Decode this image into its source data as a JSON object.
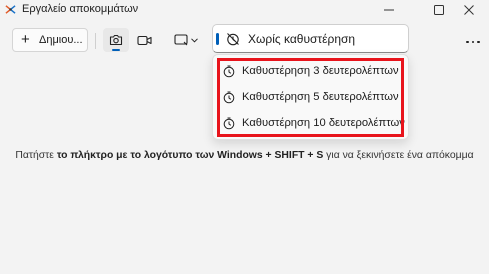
{
  "window": {
    "title": "Εργαλείο αποκομμάτων",
    "minimize_icon": "minimize-icon",
    "maximize_icon": "maximize-icon",
    "close_icon": "close-icon"
  },
  "toolbar": {
    "new_label": "Δημιου...",
    "snip_mode_icon": "camera-icon",
    "record_mode_icon": "video-camera-icon",
    "shape_icon": "rectangle-snip-icon",
    "more_icon": "more-icon"
  },
  "delay": {
    "selected": "Χωρίς καθυστέρηση",
    "options": [
      "Καθυστέρηση 3 δευτερολέπτων",
      "Καθυστέρηση 5 δευτερολέπτων",
      "Καθυστέρηση 10 δευτερολέπτων"
    ]
  },
  "hint": {
    "part1": "Πατήστε ",
    "part2": "το πλήκτρο με το λογότυπο των Windows + SHIFT + S",
    "part3": " για να ξεκινήσετε ένα απόκομμα"
  },
  "colors": {
    "accent": "#005fb8",
    "highlight_border": "#e8141c",
    "background": "#f3f3f3"
  }
}
